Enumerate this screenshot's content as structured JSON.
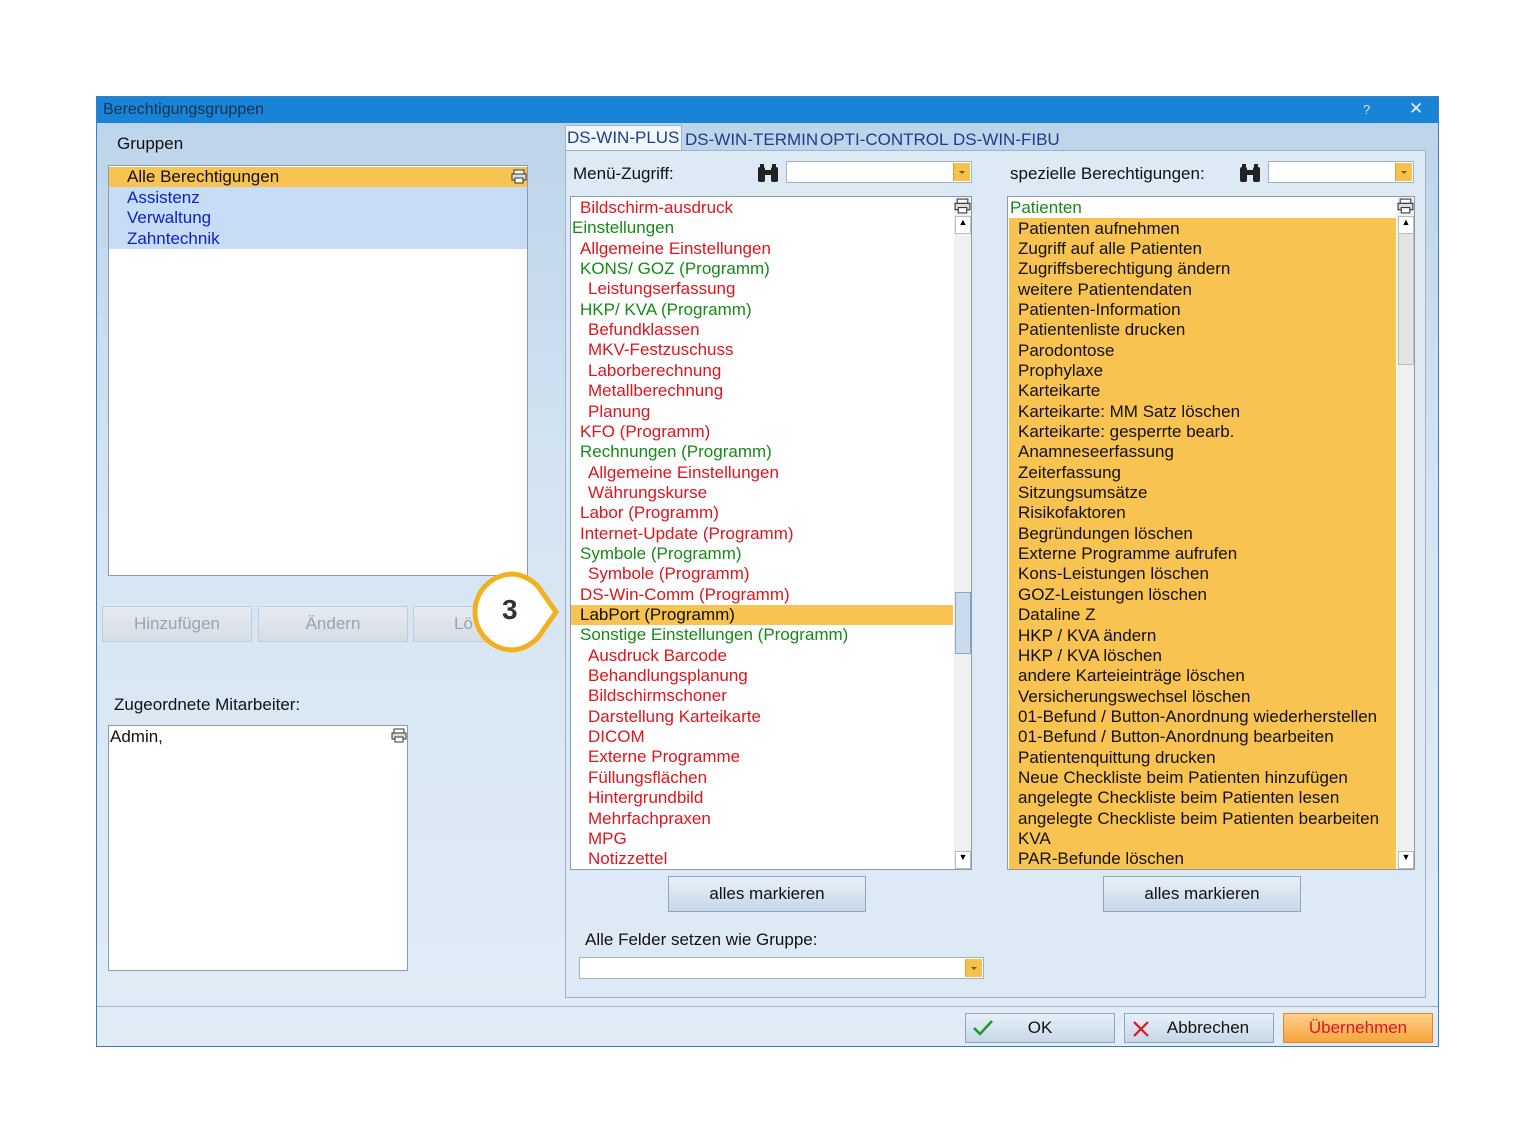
{
  "window": {
    "title": "Berechtigungsgruppen",
    "help": "?",
    "close": "✕"
  },
  "groups": {
    "label": "Gruppen",
    "items": [
      "Alle Berechtigungen",
      "Assistenz",
      "Verwaltung",
      "Zahntechnik"
    ],
    "selected": "Alle Berechtigungen",
    "buttons": {
      "add": "Hinzufügen",
      "edit": "Ändern",
      "delete": "Lö"
    }
  },
  "employees": {
    "label": "Zugeordnete Mitarbeiter:",
    "items": [
      "Admin,"
    ]
  },
  "tabs": [
    "DS-WIN-PLUS",
    "DS-WIN-TERMIN",
    "OPTI-CONTROL",
    "DS-WIN-FIBU"
  ],
  "menu_access": {
    "label": "Menü-Zugriff:",
    "search_value": "",
    "items": [
      {
        "text": "Bildschirm-ausdruck",
        "color": "#e0141c",
        "indent": 1
      },
      {
        "text": "Einstellungen",
        "color": "#168a16",
        "indent": 0
      },
      {
        "text": "Allgemeine Einstellungen",
        "color": "#e0141c",
        "indent": 1
      },
      {
        "text": "KONS/ GOZ (Programm)",
        "color": "#168a16",
        "indent": 1
      },
      {
        "text": "Leistungserfassung",
        "color": "#e0141c",
        "indent": 2
      },
      {
        "text": "HKP/ KVA (Programm)",
        "color": "#168a16",
        "indent": 1
      },
      {
        "text": "Befundklassen",
        "color": "#e0141c",
        "indent": 2
      },
      {
        "text": "MKV-Festzuschuss",
        "color": "#e0141c",
        "indent": 2
      },
      {
        "text": "Laborberechnung",
        "color": "#e0141c",
        "indent": 2
      },
      {
        "text": "Metallberechnung",
        "color": "#e0141c",
        "indent": 2
      },
      {
        "text": "Planung",
        "color": "#e0141c",
        "indent": 2
      },
      {
        "text": "KFO (Programm)",
        "color": "#e0141c",
        "indent": 1
      },
      {
        "text": "Rechnungen (Programm)",
        "color": "#168a16",
        "indent": 1
      },
      {
        "text": "Allgemeine Einstellungen",
        "color": "#e0141c",
        "indent": 2
      },
      {
        "text": "Währungskurse",
        "color": "#e0141c",
        "indent": 2
      },
      {
        "text": "Labor (Programm)",
        "color": "#e0141c",
        "indent": 1
      },
      {
        "text": "Internet-Update (Programm)",
        "color": "#e0141c",
        "indent": 1
      },
      {
        "text": "Symbole (Programm)",
        "color": "#168a16",
        "indent": 1
      },
      {
        "text": "Symbole (Programm)",
        "color": "#e0141c",
        "indent": 2
      },
      {
        "text": "DS-Win-Comm (Programm)",
        "color": "#e0141c",
        "indent": 1
      },
      {
        "text": "LabPort (Programm)",
        "color": "#111111",
        "indent": 1,
        "selected": true
      },
      {
        "text": "Sonstige Einstellungen (Programm)",
        "color": "#168a16",
        "indent": 1
      },
      {
        "text": "Ausdruck Barcode",
        "color": "#e0141c",
        "indent": 2
      },
      {
        "text": "Behandlungsplanung",
        "color": "#e0141c",
        "indent": 2
      },
      {
        "text": "Bildschirmschoner",
        "color": "#e0141c",
        "indent": 2
      },
      {
        "text": "Darstellung Karteikarte",
        "color": "#e0141c",
        "indent": 2
      },
      {
        "text": "DICOM",
        "color": "#e0141c",
        "indent": 2
      },
      {
        "text": "Externe Programme",
        "color": "#e0141c",
        "indent": 2
      },
      {
        "text": "Füllungsflächen",
        "color": "#e0141c",
        "indent": 2
      },
      {
        "text": "Hintergrundbild",
        "color": "#e0141c",
        "indent": 2
      },
      {
        "text": "Mehrfachpraxen",
        "color": "#e0141c",
        "indent": 2
      },
      {
        "text": "MPG",
        "color": "#e0141c",
        "indent": 2
      },
      {
        "text": "Notizzettel",
        "color": "#e0141c",
        "indent": 2
      }
    ],
    "mark_all": "alles markieren"
  },
  "special_permissions": {
    "label": "spezielle Berechtigungen:",
    "search_value": "",
    "header_item": "Patienten",
    "items": [
      "Patienten aufnehmen",
      "Zugriff auf alle Patienten",
      "Zugriffsberechtigung ändern",
      "weitere Patientendaten",
      "Patienten-Information",
      "Patientenliste drucken",
      "Parodontose",
      "Prophylaxe",
      "Karteikarte",
      "Karteikarte: MM Satz löschen",
      "Karteikarte: gesperrte bearb.",
      "Anamneseerfassung",
      "Zeiterfassung",
      "Sitzungsumsätze",
      "Risikofaktoren",
      "Begründungen löschen",
      "Externe Programme aufrufen",
      "Kons-Leistungen löschen",
      "GOZ-Leistungen löschen",
      "Dataline Z",
      "HKP / KVA ändern",
      "HKP / KVA löschen",
      "andere Karteieinträge löschen",
      "Versicherungswechsel löschen",
      "01-Befund / Button-Anordnung wiederherstellen",
      "01-Befund / Button-Anordnung bearbeiten",
      "Patientenquittung drucken",
      "Neue Checkliste beim Patienten hinzufügen",
      "angelegte Checkliste beim Patienten lesen",
      "angelegte Checkliste beim Patienten bearbeiten",
      "KVA",
      "PAR-Befunde löschen"
    ],
    "mark_all": "alles markieren"
  },
  "copy_group": {
    "label": "Alle Felder setzen wie Gruppe:",
    "value": ""
  },
  "footer": {
    "ok": "OK",
    "cancel": "Abbrechen",
    "apply": "Übernehmen"
  },
  "callout": {
    "number": "3"
  },
  "colors": {
    "selection": "#f8c350",
    "group_highlight": "#c7ddf6",
    "group_text": "#1020c8",
    "accent": "#1883d7"
  }
}
